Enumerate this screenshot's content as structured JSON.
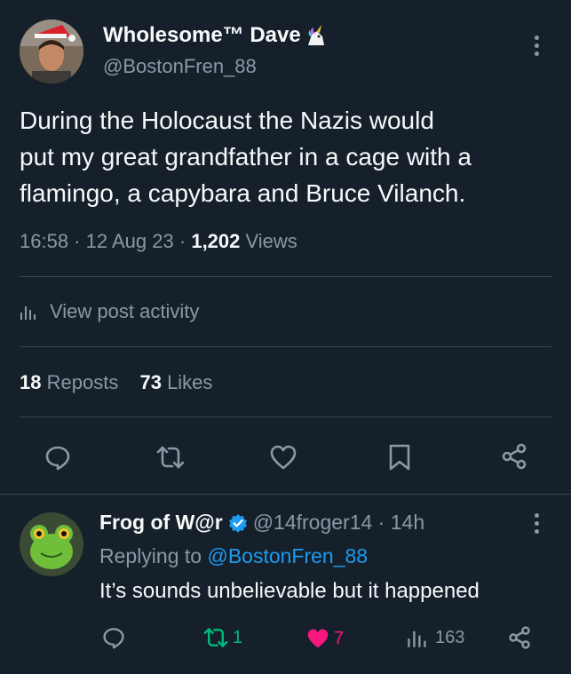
{
  "post": {
    "author_name": "Wholesome™ Dave",
    "handle": "@BostonFren_88",
    "text_lines": [
      "During the Holocaust the Nazis would",
      "put my great grandfather in a cage with a",
      "flamingo, a  capybara and Bruce Vilanch."
    ],
    "time": "16:58",
    "date": "12 Aug 23",
    "views_count": "1,202",
    "views_label": "Views",
    "activity_label": "View post activity",
    "reposts_count": "18",
    "reposts_label": "Reposts",
    "likes_count": "73",
    "likes_label": "Likes"
  },
  "reply": {
    "author_name": "Frog of W@r",
    "handle": "@14froger14",
    "age": "14h",
    "replying_prefix": "Replying to",
    "replying_handle": "@BostonFren_88",
    "text": "It’s sounds unbelievable but it happened",
    "reposts": "1",
    "likes": "7",
    "views": "163"
  },
  "colors": {
    "background": "#15202b",
    "text": "#f7f9f9",
    "muted": "#8b98a5",
    "link": "#1d9bf0",
    "repost_active": "#00ba7c",
    "like_active": "#f91880",
    "verified": "#1d9bf0"
  },
  "icons": {
    "more": "more-vertical-icon",
    "reply": "comment-icon",
    "repost": "repost-icon",
    "like": "heart-icon",
    "bookmark": "bookmark-icon",
    "share": "share-icon",
    "analytics": "bar-chart-icon",
    "verified": "verified-badge-icon",
    "emoji": "unicorn-emoji"
  }
}
